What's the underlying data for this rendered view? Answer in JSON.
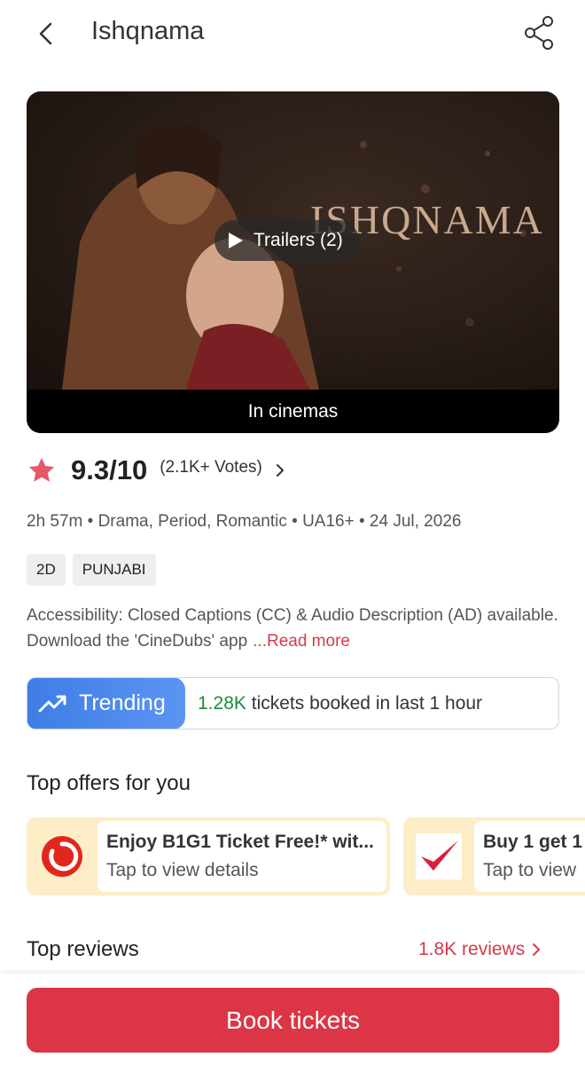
{
  "header": {
    "title": "Ishqnama",
    "back_icon": "chevron-left-icon",
    "share_icon": "share-icon"
  },
  "poster": {
    "title_art": "ISHQNAMA",
    "trailer_label": "Trailers (2)",
    "status_label": "In cinemas"
  },
  "rating": {
    "score": "9.3/10",
    "votes": "(2.1K+ Votes)",
    "star_color": "#e8576b"
  },
  "meta": "2h 57m • Drama, Period, Romantic • UA16+ • 24 Jul, 2026",
  "tags": [
    "2D",
    "PUNJABI"
  ],
  "accessibility": {
    "text": "Accessibility: Closed Captions (CC) & Audio Description (AD) available. Download the 'CineDubs' app",
    "read_more": "...Read more"
  },
  "trending": {
    "label": "Trending",
    "count": "1.28K",
    "text": "tickets booked in last 1 hour"
  },
  "offers": {
    "title": "Top offers for you",
    "items": [
      {
        "title": "Enjoy B1G1 Ticket Free!* wit...",
        "subtitle": "Tap to view details",
        "logo": "red-circle-logo"
      },
      {
        "title": "Buy 1 get 1",
        "subtitle": "Tap to view",
        "logo": "red-check-logo"
      }
    ]
  },
  "reviews": {
    "title": "Top reviews",
    "count_label": "1.8K reviews"
  },
  "cta": {
    "label": "Book tickets"
  },
  "colors": {
    "accent": "#dc3545",
    "trending_blue": "#3f7de6",
    "success_green": "#1f8a3a"
  }
}
